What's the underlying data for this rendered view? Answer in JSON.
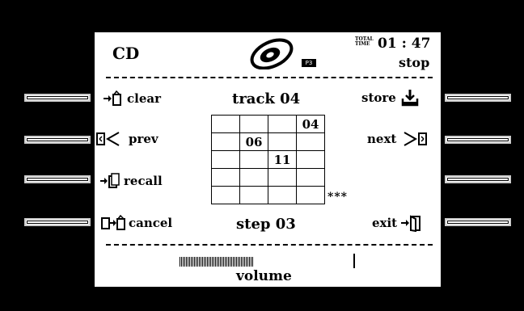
{
  "header": {
    "source": "CD",
    "total_time_label": "TOTAL TIME",
    "time": "01 : 47",
    "status": "stop",
    "badge": "P3"
  },
  "menu": {
    "clear": "clear",
    "prev": "prev",
    "recall": "recall",
    "cancel": "cancel",
    "store": "store",
    "next": "next",
    "exit": "exit"
  },
  "program": {
    "track": "track 04",
    "step": "step 03",
    "more": "***",
    "grid": [
      [
        "",
        "",
        "",
        "04"
      ],
      [
        "",
        "06",
        "",
        ""
      ],
      [
        "",
        "",
        "11",
        ""
      ],
      [
        "",
        "",
        "",
        ""
      ],
      [
        "",
        "",
        "",
        ""
      ]
    ]
  },
  "volume": {
    "label": "volume",
    "level": 0.42
  },
  "icons": {
    "disc": "cd-disc-icon",
    "clear": "arrow-to-device-icon",
    "prev": "prev-icon",
    "recall": "recall-icon",
    "cancel": "cancel-icon",
    "store": "store-icon",
    "next": "next-icon",
    "exit": "exit-icon"
  }
}
